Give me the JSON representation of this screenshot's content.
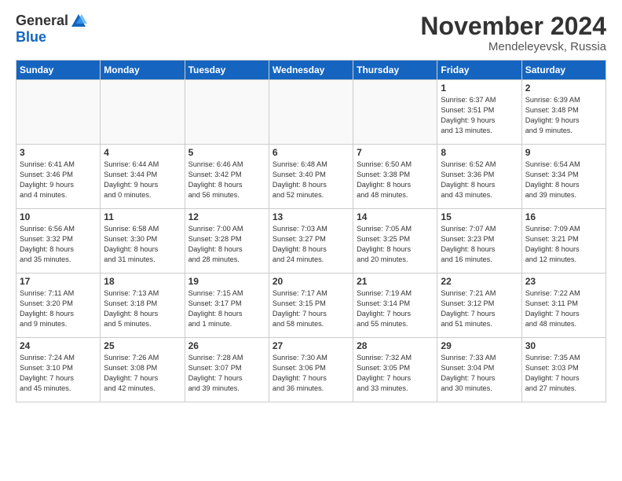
{
  "logo": {
    "general": "General",
    "blue": "Blue"
  },
  "title": "November 2024",
  "location": "Mendeleyevsk, Russia",
  "headers": [
    "Sunday",
    "Monday",
    "Tuesday",
    "Wednesday",
    "Thursday",
    "Friday",
    "Saturday"
  ],
  "weeks": [
    [
      {
        "day": "",
        "info": ""
      },
      {
        "day": "",
        "info": ""
      },
      {
        "day": "",
        "info": ""
      },
      {
        "day": "",
        "info": ""
      },
      {
        "day": "",
        "info": ""
      },
      {
        "day": "1",
        "info": "Sunrise: 6:37 AM\nSunset: 3:51 PM\nDaylight: 9 hours\nand 13 minutes."
      },
      {
        "day": "2",
        "info": "Sunrise: 6:39 AM\nSunset: 3:48 PM\nDaylight: 9 hours\nand 9 minutes."
      }
    ],
    [
      {
        "day": "3",
        "info": "Sunrise: 6:41 AM\nSunset: 3:46 PM\nDaylight: 9 hours\nand 4 minutes."
      },
      {
        "day": "4",
        "info": "Sunrise: 6:44 AM\nSunset: 3:44 PM\nDaylight: 9 hours\nand 0 minutes."
      },
      {
        "day": "5",
        "info": "Sunrise: 6:46 AM\nSunset: 3:42 PM\nDaylight: 8 hours\nand 56 minutes."
      },
      {
        "day": "6",
        "info": "Sunrise: 6:48 AM\nSunset: 3:40 PM\nDaylight: 8 hours\nand 52 minutes."
      },
      {
        "day": "7",
        "info": "Sunrise: 6:50 AM\nSunset: 3:38 PM\nDaylight: 8 hours\nand 48 minutes."
      },
      {
        "day": "8",
        "info": "Sunrise: 6:52 AM\nSunset: 3:36 PM\nDaylight: 8 hours\nand 43 minutes."
      },
      {
        "day": "9",
        "info": "Sunrise: 6:54 AM\nSunset: 3:34 PM\nDaylight: 8 hours\nand 39 minutes."
      }
    ],
    [
      {
        "day": "10",
        "info": "Sunrise: 6:56 AM\nSunset: 3:32 PM\nDaylight: 8 hours\nand 35 minutes."
      },
      {
        "day": "11",
        "info": "Sunrise: 6:58 AM\nSunset: 3:30 PM\nDaylight: 8 hours\nand 31 minutes."
      },
      {
        "day": "12",
        "info": "Sunrise: 7:00 AM\nSunset: 3:28 PM\nDaylight: 8 hours\nand 28 minutes."
      },
      {
        "day": "13",
        "info": "Sunrise: 7:03 AM\nSunset: 3:27 PM\nDaylight: 8 hours\nand 24 minutes."
      },
      {
        "day": "14",
        "info": "Sunrise: 7:05 AM\nSunset: 3:25 PM\nDaylight: 8 hours\nand 20 minutes."
      },
      {
        "day": "15",
        "info": "Sunrise: 7:07 AM\nSunset: 3:23 PM\nDaylight: 8 hours\nand 16 minutes."
      },
      {
        "day": "16",
        "info": "Sunrise: 7:09 AM\nSunset: 3:21 PM\nDaylight: 8 hours\nand 12 minutes."
      }
    ],
    [
      {
        "day": "17",
        "info": "Sunrise: 7:11 AM\nSunset: 3:20 PM\nDaylight: 8 hours\nand 9 minutes."
      },
      {
        "day": "18",
        "info": "Sunrise: 7:13 AM\nSunset: 3:18 PM\nDaylight: 8 hours\nand 5 minutes."
      },
      {
        "day": "19",
        "info": "Sunrise: 7:15 AM\nSunset: 3:17 PM\nDaylight: 8 hours\nand 1 minute."
      },
      {
        "day": "20",
        "info": "Sunrise: 7:17 AM\nSunset: 3:15 PM\nDaylight: 7 hours\nand 58 minutes."
      },
      {
        "day": "21",
        "info": "Sunrise: 7:19 AM\nSunset: 3:14 PM\nDaylight: 7 hours\nand 55 minutes."
      },
      {
        "day": "22",
        "info": "Sunrise: 7:21 AM\nSunset: 3:12 PM\nDaylight: 7 hours\nand 51 minutes."
      },
      {
        "day": "23",
        "info": "Sunrise: 7:22 AM\nSunset: 3:11 PM\nDaylight: 7 hours\nand 48 minutes."
      }
    ],
    [
      {
        "day": "24",
        "info": "Sunrise: 7:24 AM\nSunset: 3:10 PM\nDaylight: 7 hours\nand 45 minutes."
      },
      {
        "day": "25",
        "info": "Sunrise: 7:26 AM\nSunset: 3:08 PM\nDaylight: 7 hours\nand 42 minutes."
      },
      {
        "day": "26",
        "info": "Sunrise: 7:28 AM\nSunset: 3:07 PM\nDaylight: 7 hours\nand 39 minutes."
      },
      {
        "day": "27",
        "info": "Sunrise: 7:30 AM\nSunset: 3:06 PM\nDaylight: 7 hours\nand 36 minutes."
      },
      {
        "day": "28",
        "info": "Sunrise: 7:32 AM\nSunset: 3:05 PM\nDaylight: 7 hours\nand 33 minutes."
      },
      {
        "day": "29",
        "info": "Sunrise: 7:33 AM\nSunset: 3:04 PM\nDaylight: 7 hours\nand 30 minutes."
      },
      {
        "day": "30",
        "info": "Sunrise: 7:35 AM\nSunset: 3:03 PM\nDaylight: 7 hours\nand 27 minutes."
      }
    ]
  ]
}
